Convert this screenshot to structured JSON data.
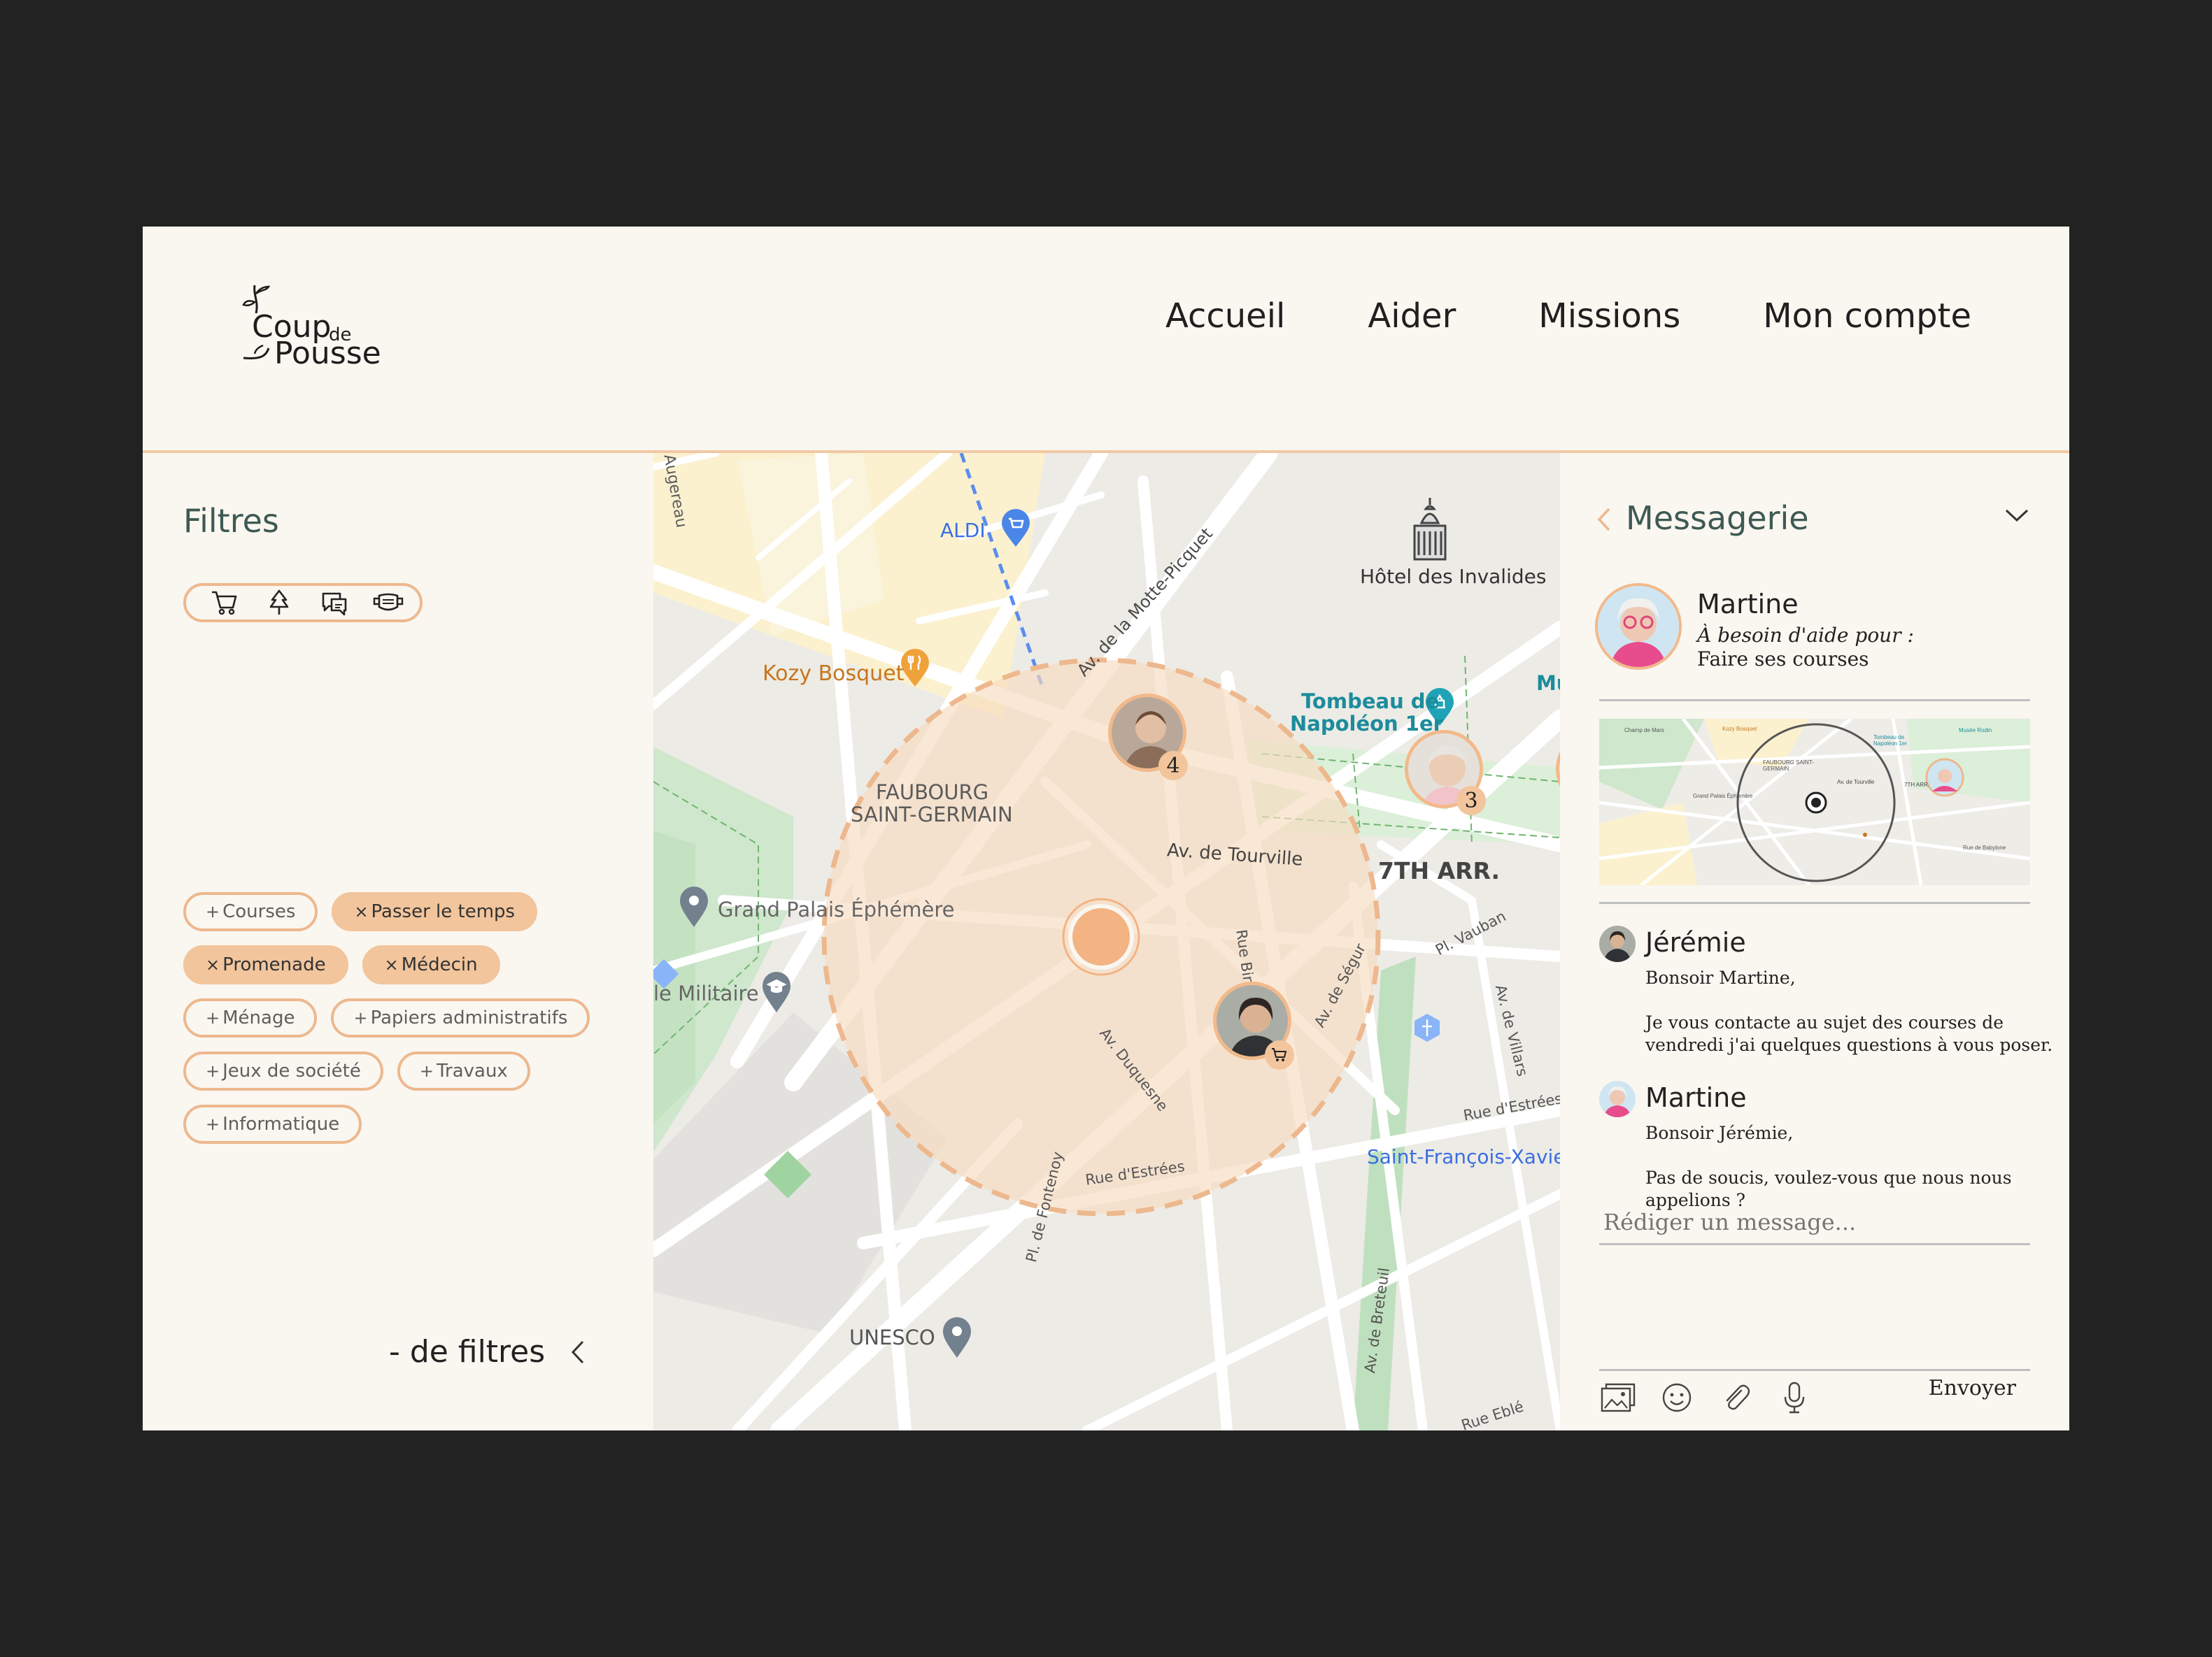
{
  "brand": {
    "line1": "Coup",
    "line1_small": "de",
    "line2": "Pousse"
  },
  "nav": {
    "home": "Accueil",
    "help": "Aider",
    "missions": "Missions",
    "account": "Mon compte"
  },
  "filters": {
    "title": "Filtres",
    "category_icons": [
      "cart-icon",
      "tree-icon",
      "chat-bubbles-icon",
      "mask-icon"
    ],
    "chips": [
      {
        "symbol": "+",
        "label": "Courses",
        "active": false
      },
      {
        "symbol": "×",
        "label": "Passer le temps",
        "active": true
      },
      {
        "symbol": "×",
        "label": "Promenade",
        "active": true
      },
      {
        "symbol": "×",
        "label": "Médecin",
        "active": true
      },
      {
        "symbol": "+",
        "label": "Ménage",
        "active": false
      },
      {
        "symbol": "+",
        "label": "Papiers administratifs",
        "active": false
      },
      {
        "symbol": "+",
        "label": "Jeux de société",
        "active": false
      },
      {
        "symbol": "+",
        "label": "Travaux",
        "active": false
      },
      {
        "symbol": "+",
        "label": "Informatique",
        "active": false
      }
    ],
    "less": "- de filtres"
  },
  "map": {
    "labels": {
      "augereau": "Augereau",
      "aldi": "ALDI",
      "motte": "Av. de la Motte-Picquet",
      "invalides": "Hôtel des Invalides",
      "kozy": "Kozy Bosquet",
      "tombeau1": "Tombeau de",
      "tombeau2": "Napoléon 1er",
      "mu": "Mu",
      "faubourg1": "FAUBOURG",
      "faubourg2": "SAINT-GERMAIN",
      "tourville": "Av. de Tourville",
      "arr": "7TH ARR.",
      "grandpalais": "Grand Palais Éphémère",
      "militaire": "le Militaire",
      "rue_bir": "Rue Bir",
      "segur": "Av. de Ségur",
      "duquesne": "Av. Duquesne",
      "vauban": "Pl. Vauban",
      "villars": "Av. de Villars",
      "estrees1": "Rue d'Estrées",
      "estrees2": "Rue d'Estrées",
      "sfx": "Saint-François-Xavier",
      "fontenoy": "Pl. de Fontenoy",
      "unesco": "UNESCO",
      "breteuil": "Av. de Breteuil",
      "eble": "Rue Eblé"
    },
    "badges": {
      "a": "4",
      "b": "3"
    }
  },
  "messenger": {
    "title": "Messagerie",
    "contact": {
      "name": "Martine",
      "need": "À besoin d'aide pour :",
      "task": "Faire ses courses"
    },
    "minimap_labels": [
      "Champ de Mars",
      "Kozy Bosquet",
      "Tombeau de Napoléon 1er",
      "Musée Rodin",
      "FAUBOURG SAINT-GERMAIN",
      "Av. de Tourville",
      "7TH ARR.",
      "Grand Palais Éphémère",
      "Rue de Babylone"
    ],
    "messages": [
      {
        "author": "Jérémie",
        "lines": [
          "Bonsoir Martine,",
          "",
          "Je vous contacte au sujet des courses de",
          "vendredi j'ai quelques questions à vous poser."
        ]
      },
      {
        "author": "Martine",
        "lines": [
          "Bonsoir Jérémie,",
          "",
          "Pas de soucis, voulez-vous que nous nous",
          "appelions ?"
        ]
      }
    ],
    "compose_placeholder": "Rédiger un message...",
    "send": "Envoyer"
  },
  "colors": {
    "accent": "#EDB88E",
    "accent_fill": "#F2C59C",
    "title_green": "#3d5a53",
    "page_bg": "#FAF6F0",
    "outer_bg": "#222222"
  }
}
